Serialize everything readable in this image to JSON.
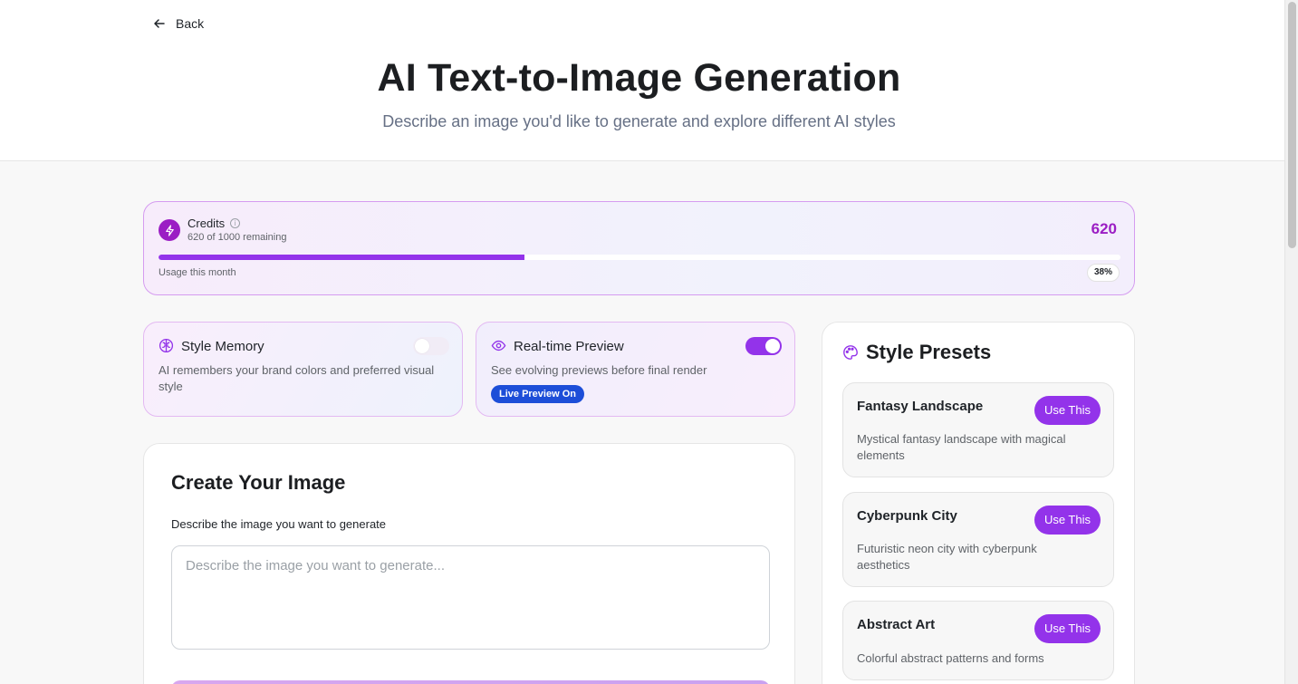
{
  "header": {
    "back_label": "Back",
    "title": "AI Text-to-Image Generation",
    "subtitle": "Describe an image you'd like to generate and explore different AI styles"
  },
  "credits": {
    "label": "Credits",
    "remaining_text": "620 of 1000 remaining",
    "count": "620",
    "usage_label": "Usage this month",
    "usage_percent_text": "38%",
    "progress_fraction": 0.38,
    "accent_color": "#9b1ec4"
  },
  "features": {
    "style_memory": {
      "title": "Style Memory",
      "description": "AI remembers your brand colors and preferred visual style",
      "icon": "brain-icon",
      "enabled": false
    },
    "realtime_preview": {
      "title": "Real-time Preview",
      "description": "See evolving previews before final render",
      "icon": "eye-icon",
      "enabled": true,
      "badge": "Live Preview On"
    }
  },
  "create": {
    "heading": "Create Your Image",
    "prompt_label": "Describe the image you want to generate",
    "prompt_placeholder": "Describe the image you want to generate...",
    "prompt_value": ""
  },
  "presets": {
    "heading": "Style Presets",
    "icon": "palette-icon",
    "items": [
      {
        "name": "Fantasy Landscape",
        "description": "Mystical fantasy landscape with magical elements",
        "button": "Use This"
      },
      {
        "name": "Cyberpunk City",
        "description": "Futuristic neon city with cyberpunk aesthetics",
        "button": "Use This"
      },
      {
        "name": "Abstract Art",
        "description": "Colorful abstract patterns and forms",
        "button": "Use This"
      }
    ]
  },
  "colors": {
    "primary": "#9333ea",
    "badge_blue": "#1d4ed8"
  }
}
